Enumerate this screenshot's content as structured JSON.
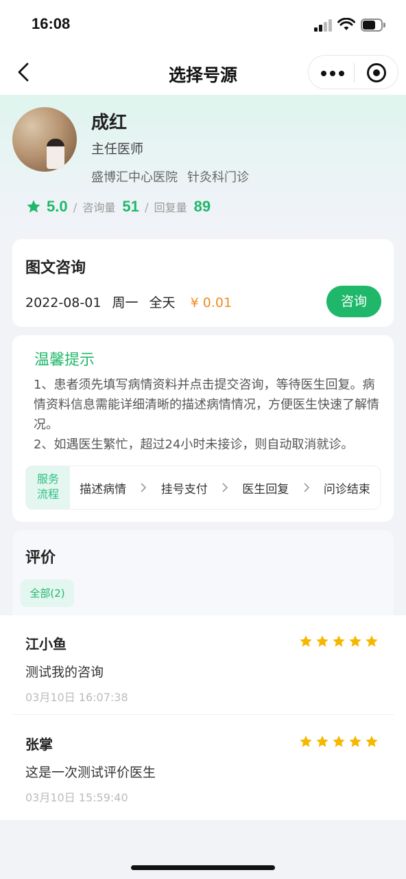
{
  "status_bar": {
    "time": "16:08"
  },
  "nav": {
    "title": "选择号源",
    "back_icon": "chevron-left-icon",
    "more_icon": "more-dots-icon",
    "target_icon": "target-icon"
  },
  "doctor": {
    "name": "成红",
    "title": "主任医师",
    "hospital": "盛博汇中心医院",
    "department": "针灸科门诊",
    "rating": "5.0",
    "consult_label": "咨询量",
    "consult_count": "51",
    "reply_label": "回复量",
    "reply_count": "89",
    "separator": "/"
  },
  "consult": {
    "heading": "图文咨询",
    "date": "2022-08-01",
    "weekday": "周一",
    "period": "全天",
    "price": "¥ 0.01",
    "button_label": "咨询"
  },
  "tips": {
    "title": "温馨提示",
    "line1": "1、患者须先填写病情资料并点击提交咨询，等待医生回复。病情资料信息需能详细清晰的描述病情情况，方便医生快速了解情况。",
    "line2": "2、如遇医生繁忙，超过24小时未接诊，则自动取消就诊。",
    "flow_label_1": "服务",
    "flow_label_2": "流程",
    "steps": [
      "描述病情",
      "挂号支付",
      "医生回复",
      "问诊结束"
    ]
  },
  "reviews": {
    "heading": "评价",
    "filter_label": "全部(2)",
    "items": [
      {
        "name": "江小鱼",
        "rating": 5,
        "text": "测试我的咨询",
        "time": "03月10日 16:07:38"
      },
      {
        "name": "张掌",
        "rating": 5,
        "text": "这是一次测试评价医生",
        "time": "03月10日 15:59:40"
      }
    ]
  },
  "colors": {
    "accent": "#1fb86a",
    "price": "#f08a20",
    "star": "#f5b800"
  }
}
